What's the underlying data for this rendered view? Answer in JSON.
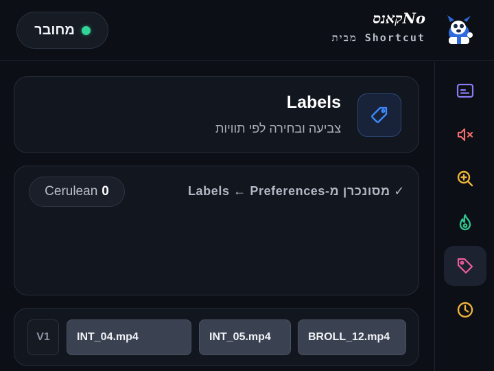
{
  "header": {
    "status_label": "מחובר",
    "brand_logo": "קאנסNo",
    "brand_subtitle": "מבית Shortcut"
  },
  "labels_card": {
    "title": "Labels",
    "subtitle": "צביעה ובחירה לפי תוויות"
  },
  "sync_card": {
    "sync_text": "✓ מסונכרן מ-Labels ← Preferences",
    "chip_name": "Cerulean",
    "chip_count": "0"
  },
  "timeline": {
    "track_label": "V1",
    "clips": [
      "INT_04.mp4",
      "INT_05.mp4",
      "BROLL_12.mp4"
    ]
  },
  "sidebar": {
    "items": [
      {
        "icon": "subtitles-icon",
        "color": "#8b7cf6"
      },
      {
        "icon": "mute-icon",
        "color": "#f26d6d"
      },
      {
        "icon": "zoom-in-icon",
        "color": "#f0b43c"
      },
      {
        "icon": "flame-icon",
        "color": "#33c48d"
      },
      {
        "icon": "tag-icon",
        "color": "#ef5d9c",
        "active": true
      },
      {
        "icon": "clock-icon",
        "color": "#f0b43c"
      }
    ]
  },
  "colors": {
    "accent_blue": "#3d8bff",
    "status_green": "#33d49a"
  }
}
